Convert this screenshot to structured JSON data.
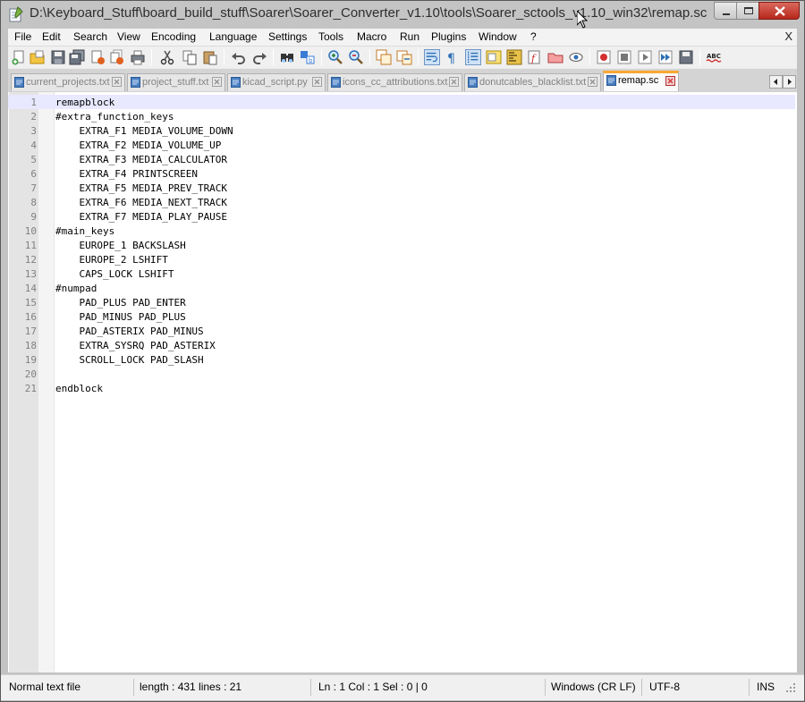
{
  "window": {
    "title": "D:\\Keyboard_Stuff\\board_build_stuff\\Soarer\\Soarer_Converter_v1.10\\tools\\Soarer_sctools_v1.10_win32\\remap.sc -..."
  },
  "menubar": {
    "items": [
      "File",
      "Edit",
      "Search",
      "View",
      "Encoding",
      "Language",
      "Settings",
      "Tools",
      "Macro",
      "Run",
      "Plugins",
      "Window",
      "?"
    ],
    "close_label": "X"
  },
  "toolbar": {
    "buttons": [
      "new-file",
      "open-file",
      "save",
      "save-all",
      "close",
      "close-all",
      "print",
      "cut",
      "copy",
      "paste",
      "undo",
      "redo",
      "find",
      "replace",
      "zoom-in",
      "zoom-out",
      "sync-vertical",
      "sync-horizontal",
      "word-wrap",
      "show-all-characters",
      "indent-guide",
      "user-defined-language",
      "document-map",
      "function-list",
      "folder-as-workspace",
      "monitoring",
      "record-macro",
      "stop-recording",
      "play-macro",
      "run-macro-multiple",
      "save-macro",
      "spell-check"
    ]
  },
  "tabs": [
    {
      "label": "current_projects.txt",
      "active": false
    },
    {
      "label": "project_stuff.txt",
      "active": false
    },
    {
      "label": "kicad_script.py",
      "active": false
    },
    {
      "label": "icons_cc_attributions.txt",
      "active": false
    },
    {
      "label": "donutcables_blacklist.txt",
      "active": false
    },
    {
      "label": "remap.sc",
      "active": true
    }
  ],
  "editor": {
    "lines": [
      "remapblock",
      "#extra_function_keys",
      "    EXTRA_F1 MEDIA_VOLUME_DOWN",
      "    EXTRA_F2 MEDIA_VOLUME_UP",
      "    EXTRA_F3 MEDIA_CALCULATOR",
      "    EXTRA_F4 PRINTSCREEN",
      "    EXTRA_F5 MEDIA_PREV_TRACK",
      "    EXTRA_F6 MEDIA_NEXT_TRACK",
      "    EXTRA_F7 MEDIA_PLAY_PAUSE",
      "#main_keys",
      "    EUROPE_1 BACKSLASH",
      "    EUROPE_2 LSHIFT",
      "    CAPS_LOCK LSHIFT",
      "#numpad",
      "    PAD_PLUS PAD_ENTER",
      "    PAD_MINUS PAD_PLUS",
      "    PAD_ASTERIX PAD_MINUS",
      "    EXTRA_SYSRQ PAD_ASTERIX",
      "    SCROLL_LOCK PAD_SLASH",
      "",
      "endblock"
    ],
    "current_line": 1
  },
  "statusbar": {
    "file_type": "Normal text file",
    "length_lines": "length : 431    lines : 21",
    "position": "Ln : 1    Col : 1    Sel : 0 | 0",
    "eol": "Windows (CR LF)",
    "encoding": "UTF-8",
    "mode": "INS"
  },
  "colors": {
    "active_tab_accent": "#faa732",
    "current_line_highlight": "#e8e8ff",
    "close_button": "#c8392b",
    "tab_close_icon": "#d23c3c"
  }
}
